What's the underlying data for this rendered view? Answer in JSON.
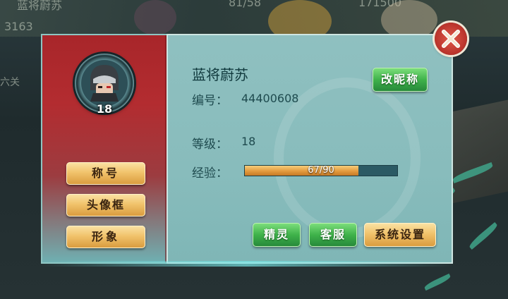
{
  "background": {
    "top_left_text": "蓝将蔚苏",
    "score_left": "3163",
    "top_mid_text": "81/58",
    "top_right_text": "171500",
    "side_text": "六关"
  },
  "profile": {
    "name": "蓝将蔚苏",
    "level": "18",
    "rename_button": "改昵称",
    "id_label": "编号：",
    "id_value": "44400608",
    "level_label": "等级：",
    "level_value": "18",
    "exp_label": "经验：",
    "exp_text": "67/90",
    "exp_current": 67,
    "exp_max": 90
  },
  "side_buttons": {
    "title": "称号",
    "frame": "头像框",
    "image": "形象"
  },
  "bottom_buttons": {
    "spirit": "精灵",
    "service": "客服",
    "settings": "系统设置"
  },
  "colors": {
    "panel_red": "#a8262a",
    "panel_teal": "#88bcbc",
    "button_green": "#3fb24a",
    "button_gold": "#f1c36c",
    "exp_fill": "#e39a3e",
    "close_red": "#b8322a"
  },
  "icons": {
    "close": "close-x-icon",
    "avatar": "helmeted-warrior-avatar"
  }
}
